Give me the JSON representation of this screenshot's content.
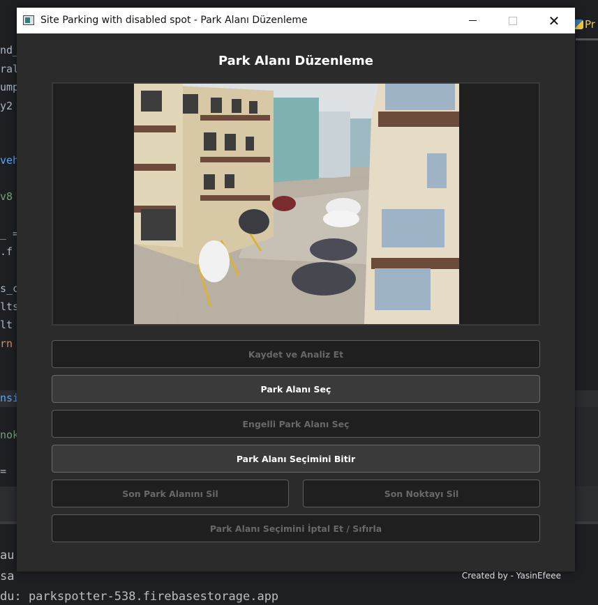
{
  "ide": {
    "code_fragments": [
      {
        "text": "nd_",
        "color": "#a9b7c6"
      },
      {
        "text": "ral",
        "color": "#a9b7c6"
      },
      {
        "text": "ump",
        "color": "#a9b7c6"
      },
      {
        "text": "y2",
        "color": "#a9b7c6"
      },
      {
        "text": "veh",
        "color": "#56a8f5"
      },
      {
        "text": "v8 ",
        "color": "#7a9e7e"
      },
      {
        "text": "_ =",
        "color": "#a9b7c6"
      },
      {
        "text": ".f",
        "color": "#a9b7c6"
      },
      {
        "text": "s_c",
        "color": "#a9b7c6"
      },
      {
        "text": "lts",
        "color": "#a9b7c6"
      },
      {
        "text": "lt ",
        "color": "#a9b7c6"
      },
      {
        "text": "rn ",
        "color": "#cf8e6d"
      },
      {
        "text": "nsi",
        "color": "#56a8f5"
      },
      {
        "text": "nok",
        "color": "#7a9e7e"
      },
      {
        "text": "= ",
        "color": "#a9b7c6"
      }
    ],
    "right_tab_label": "Pr",
    "console_lines": [
      "au",
      "sa",
      "du: parkspotter-538.firebasestorage.app"
    ]
  },
  "window": {
    "title": "Site Parking with disabled spot - Park Alanı Düzenleme",
    "heading": "Park Alanı Düzenleme",
    "buttons": {
      "save_analyze": "Kaydet ve Analiz Et",
      "select_spot": "Park Alanı Seç",
      "select_disabled": "Engelli Park Alanı Seç",
      "finish_selection": "Park Alanı Seçimini Bitir",
      "delete_last_spot": "Son Park Alanını Sil",
      "delete_last_point": "Son Noktayı Sil",
      "cancel_reset": "Park Alanı Seçimini İptal Et / Sıfırla"
    },
    "footer": "Created by - YasinEfeee"
  },
  "colors": {
    "window_bg": "#2b2b2b",
    "button_disabled_bg": "#1f1f1f",
    "button_active_bg": "#3a3a3a"
  }
}
